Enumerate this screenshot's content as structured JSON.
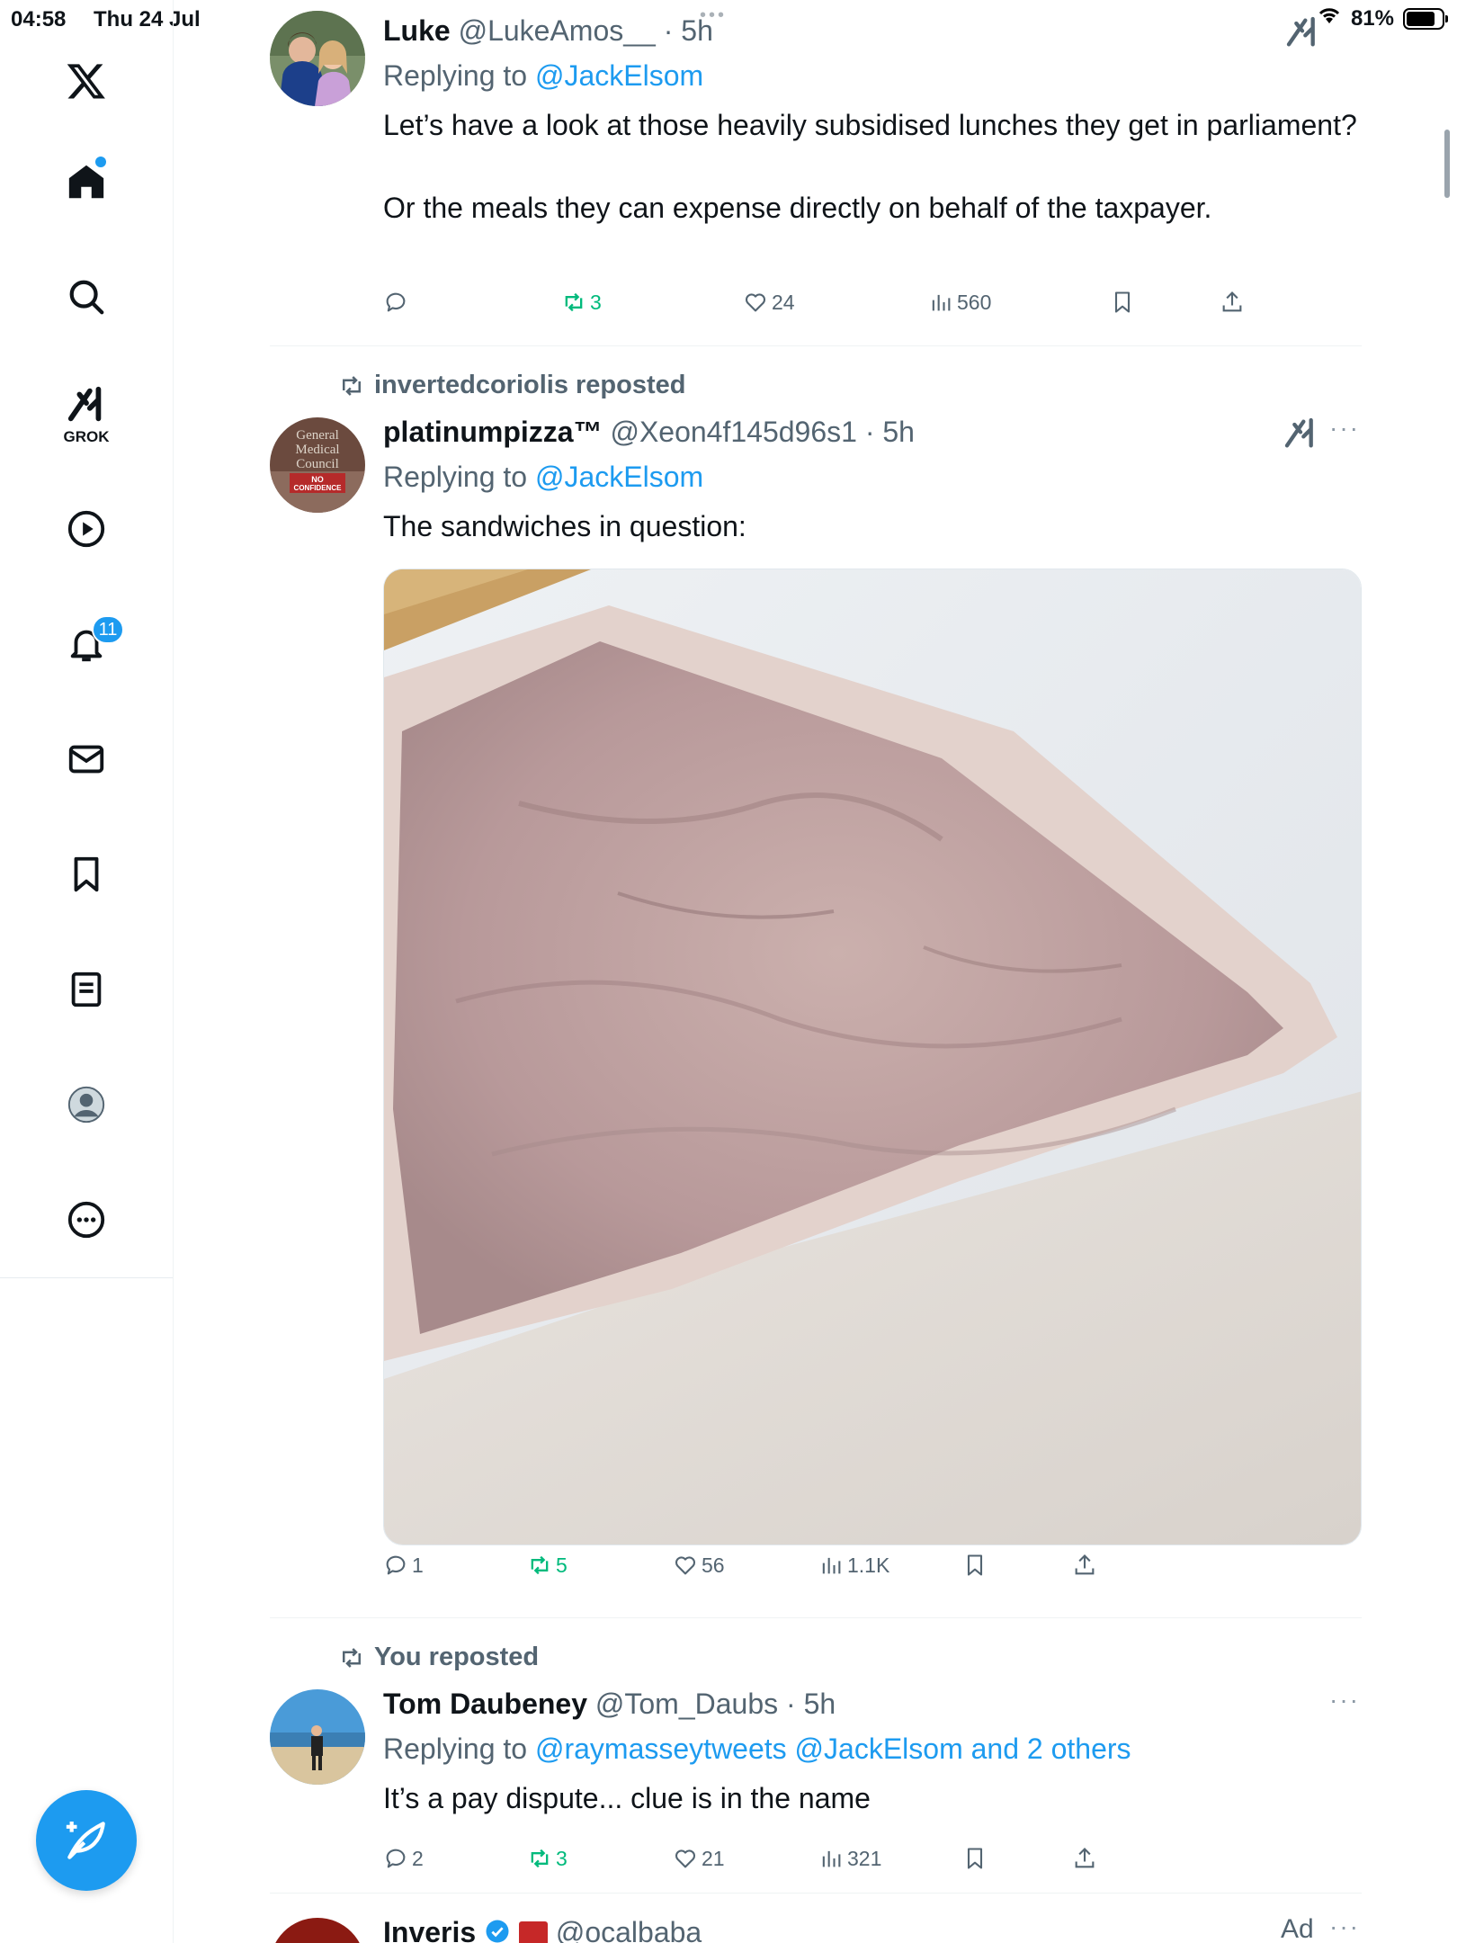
{
  "status_bar": {
    "time": "04:58",
    "date": "Thu 24 Jul",
    "battery": "81%"
  },
  "sidebar": {
    "grok_label": "GROK",
    "notifications_badge": "11",
    "items": [
      "home-icon",
      "search-icon",
      "grok-icon",
      "video-icon",
      "notifications-icon",
      "messages-icon",
      "bookmarks-icon",
      "lists-icon",
      "profile-icon",
      "more-icon"
    ]
  },
  "tweets": [
    {
      "name": "Luke",
      "handle": "@LukeAmos__",
      "time": "· 5h",
      "replying_label": "Replying to",
      "replying_to": "@JackElsom",
      "text": "Let’s have a look at those heavily subsidised lunches they get in parliament?\n\nOr the meals they can expense directly on behalf of the taxpayer.",
      "replies": "",
      "reposts": "3",
      "likes": "24",
      "views": "560"
    },
    {
      "reposted_by": "invertedcoriolis reposted",
      "name": "platinumpizza™",
      "handle": "@Xeon4f145d96s1",
      "time": "· 5h",
      "replying_label": "Replying to",
      "replying_to": "@JackElsom",
      "text": "The sandwiches in question:",
      "replies": "1",
      "reposts": "5",
      "likes": "56",
      "views": "1.1K",
      "avatar_lettering": [
        "General",
        "Medical",
        "Council",
        "NO",
        "CONFIDENCE"
      ]
    },
    {
      "reposted_by": "You reposted",
      "name": "Tom Daubeney",
      "handle": "@Tom_Daubs",
      "time": "· 5h",
      "replying_label": "Replying to",
      "replying_to": "@raymasseytweets @JackElsom and 2 others",
      "text": "It’s a pay dispute... clue is in the name",
      "replies": "2",
      "reposts": "3",
      "likes": "21",
      "views": "321"
    },
    {
      "name": "Inveris",
      "handle": "@ocalbaba",
      "ad_label": "Ad"
    }
  ],
  "colors": {
    "accent": "#1d9bf0",
    "repost_green": "#00ba7c",
    "muted": "#536471"
  }
}
